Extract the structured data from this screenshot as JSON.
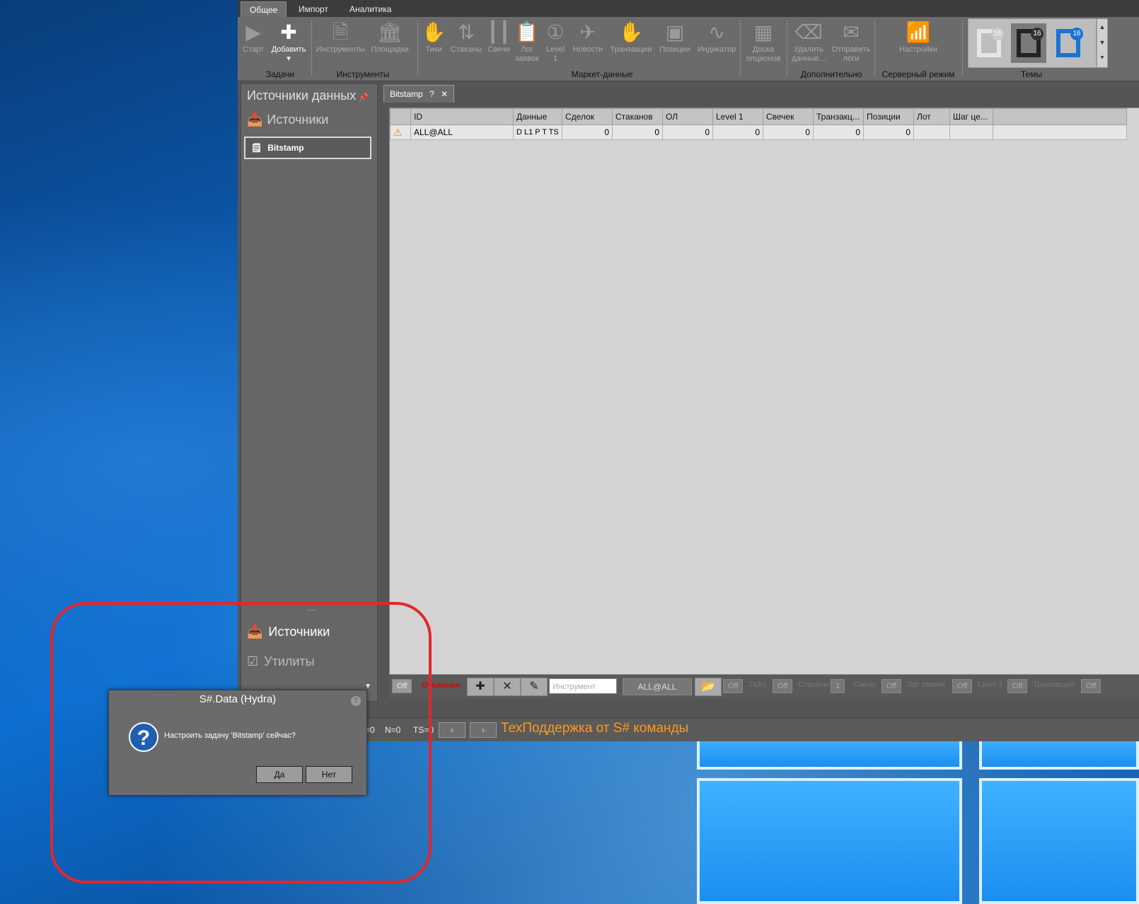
{
  "ribbon_tabs": [
    "Общее",
    "Импорт",
    "Аналитика"
  ],
  "ribbon": {
    "start": "Старт",
    "add": "Добавить",
    "instruments": "Инструменты",
    "venues": "Площадки",
    "ticks": "Тики",
    "books": "Стаканы",
    "candles": "Свечи",
    "order_log": "Лог\nзаявок",
    "level1": "Level\n1",
    "news": "Новости",
    "transactions": "Транзакции",
    "positions": "Позиции",
    "indicator": "Индикатор",
    "options_desk": "Доска\nопционов",
    "delete_data": "Удалить\nданные...",
    "send_logs": "Отправить\nлоги",
    "settings": "Настройки",
    "groups": {
      "tasks": "Задачи",
      "tools": "Инструменты",
      "market_data": "Маркет-данные",
      "extra": "Дополнительно",
      "server": "Серверный режим",
      "themes": "Темы"
    },
    "theme_badges": [
      "16",
      "16",
      "16"
    ]
  },
  "left_panel": {
    "title": "Источники данных",
    "sources_label": "Источники",
    "selected_source": "Bitstamp",
    "bottom_sources": "Источники",
    "bottom_utilities": "Утилиты",
    "splitter": "......"
  },
  "doc_tab": "Bitstamp",
  "grid": {
    "headers": [
      "",
      "ID",
      "Данные",
      "Сделок",
      "Стаканов",
      "ОЛ",
      "Level 1",
      "Свечек",
      "Транзакц...",
      "Позиции",
      "Лот",
      "Шаг це..."
    ],
    "rows": [
      {
        "id": "ALL@ALL",
        "data": "D L1 P T TS",
        "trades": "0",
        "books": "0",
        "ol": "0",
        "level1": "0",
        "candles": "0",
        "transactions": "0",
        "positions": "0",
        "lot": "",
        "step": ""
      }
    ]
  },
  "toolbar": {
    "off": "Off",
    "disabled": "Отключен",
    "instrument_placeholder": "Инструмент",
    "security": "ALL@ALL",
    "ticks": "Ticks",
    "books": "Стаканы",
    "candles": "Свечи",
    "order_log": "Лог заявок",
    "level1": "Level 1",
    "transactions": "Транзакции",
    "candle_value": "1"
  },
  "status": {
    "z": "=0",
    "n": "N=0",
    "ts": "TS=0",
    "support": "ТехПоддержка от S# команды"
  },
  "dialog": {
    "title": "S#.Data (Hydra)",
    "message": "Настроить задачу 'Bitstamp' сейчас?",
    "yes": "Да",
    "no": "Нет"
  },
  "colors": {
    "accent_orange": "#ff9a1a",
    "highlight_red": "#e2262c",
    "disabled_red": "#e00000"
  }
}
